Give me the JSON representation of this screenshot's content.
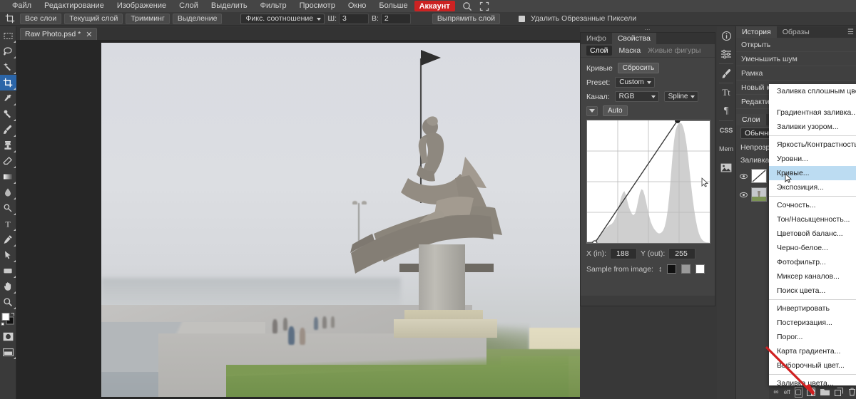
{
  "app": {
    "title": "Raw Photo.psd *",
    "accent_color": "#cc2222",
    "panel_bg": "#434343",
    "highlight_color": "#bcdcf2"
  },
  "menubar": {
    "items": [
      {
        "label": "Файл"
      },
      {
        "label": "Редактирование"
      },
      {
        "label": "Изображение"
      },
      {
        "label": "Слой"
      },
      {
        "label": "Выделить"
      },
      {
        "label": "Фильтр"
      },
      {
        "label": "Просмотр"
      },
      {
        "label": "Окно"
      },
      {
        "label": "Больше"
      }
    ],
    "account_label": "Аккаунт",
    "search_icon": "search-icon",
    "fullscreen_icon": "fullscreen-icon"
  },
  "options_bar": {
    "tool_icon": "crop-tool-icon",
    "buttons": [
      "Все слои",
      "Текущий слой",
      "Тримминг",
      "Выделение"
    ],
    "ratio_select": "Фикс. соотношение",
    "width_label": "Ш:",
    "width_value": "3",
    "height_label": "В:",
    "height_value": "2",
    "straighten_label": "Выпрямить слой",
    "delete_cropped_label": "Удалить Обрезанные Пиксели",
    "delete_cropped_checked": true
  },
  "toolbar": {
    "tools": [
      {
        "name": "marquee-tool",
        "active": false
      },
      {
        "name": "lasso-tool",
        "active": false
      },
      {
        "name": "magic-wand-tool",
        "active": false
      },
      {
        "name": "crop-tool",
        "active": true
      },
      {
        "name": "eyedropper-tool",
        "active": false
      },
      {
        "name": "healing-brush-tool",
        "active": false
      },
      {
        "name": "brush-tool",
        "active": false
      },
      {
        "name": "clone-stamp-tool",
        "active": false
      },
      {
        "name": "eraser-tool",
        "active": false
      },
      {
        "name": "gradient-tool",
        "active": false
      },
      {
        "name": "blur-tool",
        "active": false
      },
      {
        "name": "dodge-tool",
        "active": false
      },
      {
        "name": "type-tool",
        "active": false
      },
      {
        "name": "pen-tool",
        "active": false
      },
      {
        "name": "path-selection-tool",
        "active": false
      },
      {
        "name": "shape-tool",
        "active": false
      },
      {
        "name": "hand-tool",
        "active": false
      },
      {
        "name": "zoom-tool",
        "active": false
      },
      {
        "name": "foreground-background-color",
        "active": false
      },
      {
        "name": "quick-mask-toggle",
        "active": false
      },
      {
        "name": "screen-mode-toggle",
        "active": false
      }
    ]
  },
  "document_tab": {
    "name": "Raw Photo.psd *",
    "close_icon": "close-icon"
  },
  "properties_panel": {
    "tabs": [
      {
        "label": "Инфо",
        "active": false
      },
      {
        "label": "Свойства",
        "active": true
      }
    ],
    "subtabs": [
      {
        "label": "Слой",
        "active": true
      },
      {
        "label": "Маска",
        "active": false
      },
      {
        "label": "Живые фигуры",
        "active": false,
        "dim": true
      }
    ],
    "title": "Кривые",
    "reset_label": "Сбросить",
    "preset_label": "Preset:",
    "preset_value": "Custom",
    "channel_label": "Канал:",
    "channel_value": "RGB",
    "curve_type_value": "Spline",
    "auto_label": "Auto",
    "x_label": "X (in):",
    "x_value": "188",
    "y_label": "Y (out):",
    "y_value": "255",
    "sample_label": "Sample from image:",
    "swatches": [
      "#111111",
      "#9a9a9a",
      "#ffffff"
    ]
  },
  "chart_data": {
    "type": "line",
    "title": "Кривые",
    "xlabel": "X (in)",
    "ylabel": "Y (out)",
    "xlim": [
      0,
      255
    ],
    "ylim": [
      0,
      255
    ],
    "grid": true,
    "control_points": [
      {
        "x": 16,
        "y": 0
      },
      {
        "x": 188,
        "y": 255
      }
    ],
    "histogram": [
      2,
      3,
      3,
      4,
      5,
      6,
      8,
      10,
      14,
      18,
      22,
      26,
      30,
      33,
      36,
      38,
      40,
      44,
      50,
      58,
      70,
      84,
      96,
      104,
      108,
      100,
      86,
      74,
      66,
      60,
      58,
      62,
      74,
      90,
      104,
      112,
      110,
      100,
      86,
      70,
      56,
      44,
      36,
      30,
      26,
      22,
      20,
      20,
      22,
      26,
      34,
      48,
      70,
      100,
      140,
      180,
      212,
      234,
      244,
      248,
      250,
      248,
      240,
      226,
      206,
      180,
      150,
      120,
      92,
      68,
      48,
      32,
      20,
      12,
      7,
      4,
      2,
      1,
      1,
      0
    ]
  },
  "right_rail": {
    "items": [
      {
        "name": "info-icon",
        "glyph": "ⓘ"
      },
      {
        "name": "adjustments-icon",
        "glyph": "≣"
      },
      {
        "name": "brush-presets-icon",
        "glyph": "🖌"
      },
      {
        "name": "character-icon",
        "glyph": "Tt"
      },
      {
        "name": "paragraph-icon",
        "glyph": "¶"
      },
      {
        "name": "css-icon",
        "glyph": "CSS"
      },
      {
        "name": "memory-icon",
        "glyph": "Mem"
      },
      {
        "name": "image-icon",
        "glyph": "🖼"
      }
    ]
  },
  "history_panel": {
    "tabs": [
      {
        "label": "История",
        "active": true
      },
      {
        "label": "Образы",
        "active": false
      }
    ],
    "menu_icon": "panel-menu-icon",
    "items": [
      "Открыть",
      "Уменьшить шум",
      "Рамка",
      "Новый корректирующий слой",
      "Редактирование слоя"
    ]
  },
  "layers_panel": {
    "tabs": [
      {
        "label": "Слои",
        "active": true
      },
      {
        "label": "Ка",
        "active": false
      }
    ],
    "blend_mode": "Обычный",
    "opacity_label": "Непрозр.:",
    "fill_label": "Заливка:",
    "layers": [
      {
        "name": "curves-adjustment-layer",
        "thumb": "curves-thumb",
        "visible": true
      },
      {
        "name": "photo-layer",
        "thumb": "photo-thumb",
        "visible": true
      }
    ]
  },
  "layer_buttons": [
    {
      "name": "link-layers-icon",
      "glyph": "∞"
    },
    {
      "name": "layer-style-icon",
      "glyph": "eff."
    },
    {
      "name": "add-mask-icon",
      "glyph": "◻"
    },
    {
      "name": "new-adjustment-layer-icon",
      "glyph": "◐",
      "highlighted": true
    },
    {
      "name": "new-group-icon",
      "glyph": "▭"
    },
    {
      "name": "new-layer-icon",
      "glyph": "⊡"
    },
    {
      "name": "delete-layer-icon",
      "glyph": "🗑"
    }
  ],
  "adjustment_menu": {
    "groups": [
      {
        "items": [
          {
            "label": "Заливка сплошным цветом...",
            "two_line": true,
            "selected": false
          }
        ]
      },
      {
        "items": [
          {
            "label": "Градиентная заливка...",
            "selected": false
          },
          {
            "label": "Заливки узором...",
            "selected": false
          }
        ]
      },
      {
        "items": [
          {
            "label": "Яркость/Контрастность...",
            "selected": false
          },
          {
            "label": "Уровни...",
            "selected": false
          },
          {
            "label": "Кривые...",
            "selected": true
          },
          {
            "label": "Экспозиция...",
            "selected": false
          }
        ]
      },
      {
        "items": [
          {
            "label": "Сочность...",
            "selected": false
          },
          {
            "label": "Тон/Насыщенность...",
            "selected": false
          },
          {
            "label": "Цветовой баланс...",
            "selected": false
          },
          {
            "label": "Черно-белое...",
            "selected": false
          },
          {
            "label": "Фотофильтр...",
            "selected": false
          },
          {
            "label": "Миксер каналов...",
            "selected": false
          },
          {
            "label": "Поиск цвета...",
            "selected": false
          }
        ]
      },
      {
        "items": [
          {
            "label": "Инвертировать",
            "selected": false
          },
          {
            "label": "Постеризация...",
            "selected": false
          },
          {
            "label": "Порог...",
            "selected": false
          },
          {
            "label": "Карта градиента...",
            "selected": false
          },
          {
            "label": "Выборочный цвет...",
            "selected": false
          }
        ]
      },
      {
        "items": [
          {
            "label": "Заливка цвета...",
            "selected": false
          }
        ]
      }
    ]
  }
}
